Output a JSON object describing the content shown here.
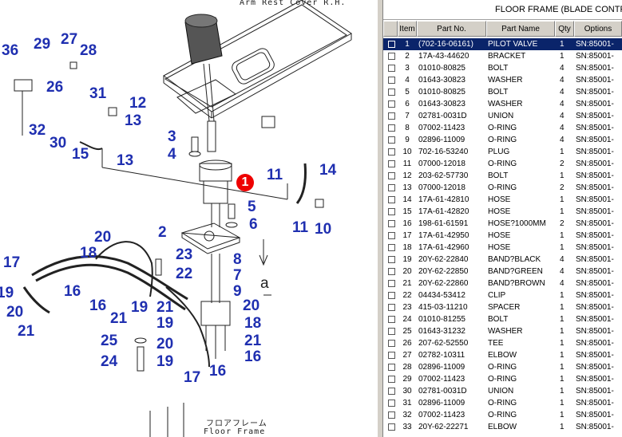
{
  "diagram": {
    "top_text": "Arm Rest Cover R.H.",
    "floor_label_jp": "フロアフレーム",
    "floor_label_en": "Floor Frame",
    "callouts": [
      {
        "id": "1",
        "label": "1",
        "selected": true
      },
      {
        "id": "36a",
        "label": "36"
      },
      {
        "id": "29",
        "label": "29"
      },
      {
        "id": "27",
        "label": "27"
      },
      {
        "id": "28",
        "label": "28"
      },
      {
        "id": "26",
        "label": "26"
      },
      {
        "id": "31",
        "label": "31"
      },
      {
        "id": "12",
        "label": "12"
      },
      {
        "id": "13a",
        "label": "13"
      },
      {
        "id": "32",
        "label": "32"
      },
      {
        "id": "30",
        "label": "30"
      },
      {
        "id": "15",
        "label": "15"
      },
      {
        "id": "13b",
        "label": "13"
      },
      {
        "id": "3",
        "label": "3"
      },
      {
        "id": "4",
        "label": "4"
      },
      {
        "id": "11a",
        "label": "11"
      },
      {
        "id": "14",
        "label": "14"
      },
      {
        "id": "5",
        "label": "5"
      },
      {
        "id": "6",
        "label": "6"
      },
      {
        "id": "11b",
        "label": "11"
      },
      {
        "id": "10",
        "label": "10"
      },
      {
        "id": "2",
        "label": "2"
      },
      {
        "id": "20a",
        "label": "20"
      },
      {
        "id": "18a",
        "label": "18"
      },
      {
        "id": "8",
        "label": "8"
      },
      {
        "id": "23",
        "label": "23"
      },
      {
        "id": "17a",
        "label": "17"
      },
      {
        "id": "22",
        "label": "22"
      },
      {
        "id": "7",
        "label": "7"
      },
      {
        "id": "9",
        "label": "9"
      },
      {
        "id": "19a",
        "label": "19"
      },
      {
        "id": "16a",
        "label": "16"
      },
      {
        "id": "16b",
        "label": "16"
      },
      {
        "id": "19b",
        "label": "19"
      },
      {
        "id": "21a",
        "label": "21"
      },
      {
        "id": "20b",
        "label": "20"
      },
      {
        "id": "21b",
        "label": "21"
      },
      {
        "id": "21c",
        "label": "21"
      },
      {
        "id": "19c",
        "label": "19"
      },
      {
        "id": "20c",
        "label": "20"
      },
      {
        "id": "18b",
        "label": "18"
      },
      {
        "id": "21d",
        "label": "21"
      },
      {
        "id": "25",
        "label": "25"
      },
      {
        "id": "20d",
        "label": "20"
      },
      {
        "id": "16c",
        "label": "16"
      },
      {
        "id": "24",
        "label": "24"
      },
      {
        "id": "19d",
        "label": "19"
      },
      {
        "id": "17b",
        "label": "17"
      },
      {
        "id": "16d",
        "label": "16"
      },
      {
        "id": "a",
        "label": "a"
      }
    ]
  },
  "panel": {
    "title": "FLOOR FRAME (BLADE CONTROL",
    "columns": [
      "Item",
      "Part No.",
      "Part Name",
      "Qty",
      "Options"
    ],
    "rows": [
      {
        "item": "1",
        "part": "(702-16-06161)",
        "name": "PILOT VALVE",
        "qty": "1",
        "opt": "SN:85001-",
        "selected": true
      },
      {
        "item": "2",
        "part": "17A-43-44620",
        "name": "BRACKET",
        "qty": "1",
        "opt": "SN:85001-"
      },
      {
        "item": "3",
        "part": "01010-80825",
        "name": "BOLT",
        "qty": "4",
        "opt": "SN:85001-"
      },
      {
        "item": "4",
        "part": "01643-30823",
        "name": "WASHER",
        "qty": "4",
        "opt": "SN:85001-"
      },
      {
        "item": "5",
        "part": "01010-80825",
        "name": "BOLT",
        "qty": "4",
        "opt": "SN:85001-"
      },
      {
        "item": "6",
        "part": "01643-30823",
        "name": "WASHER",
        "qty": "4",
        "opt": "SN:85001-"
      },
      {
        "item": "7",
        "part": "02781-0031D",
        "name": "UNION",
        "qty": "4",
        "opt": "SN:85001-"
      },
      {
        "item": "8",
        "part": "07002-11423",
        "name": "O-RING",
        "qty": "4",
        "opt": "SN:85001-"
      },
      {
        "item": "9",
        "part": "02896-11009",
        "name": "O-RING",
        "qty": "4",
        "opt": "SN:85001-"
      },
      {
        "item": "10",
        "part": "702-16-53240",
        "name": "PLUG",
        "qty": "1",
        "opt": "SN:85001-"
      },
      {
        "item": "11",
        "part": "07000-12018",
        "name": "O-RING",
        "qty": "2",
        "opt": "SN:85001-"
      },
      {
        "item": "12",
        "part": "203-62-57730",
        "name": "BOLT",
        "qty": "1",
        "opt": "SN:85001-"
      },
      {
        "item": "13",
        "part": "07000-12018",
        "name": "O-RING",
        "qty": "2",
        "opt": "SN:85001-"
      },
      {
        "item": "14",
        "part": "17A-61-42810",
        "name": "HOSE",
        "qty": "1",
        "opt": "SN:85001-"
      },
      {
        "item": "15",
        "part": "17A-61-42820",
        "name": "HOSE",
        "qty": "1",
        "opt": "SN:85001-"
      },
      {
        "item": "16",
        "part": "198-61-61591",
        "name": "HOSE?1000MM",
        "qty": "2",
        "opt": "SN:85001-"
      },
      {
        "item": "17",
        "part": "17A-61-42950",
        "name": "HOSE",
        "qty": "1",
        "opt": "SN:85001-"
      },
      {
        "item": "18",
        "part": "17A-61-42960",
        "name": "HOSE",
        "qty": "1",
        "opt": "SN:85001-"
      },
      {
        "item": "19",
        "part": "20Y-62-22840",
        "name": "BAND?BLACK",
        "qty": "4",
        "opt": "SN:85001-"
      },
      {
        "item": "20",
        "part": "20Y-62-22850",
        "name": "BAND?GREEN",
        "qty": "4",
        "opt": "SN:85001-"
      },
      {
        "item": "21",
        "part": "20Y-62-22860",
        "name": "BAND?BROWN",
        "qty": "4",
        "opt": "SN:85001-"
      },
      {
        "item": "22",
        "part": "04434-53412",
        "name": "CLIP",
        "qty": "1",
        "opt": "SN:85001-"
      },
      {
        "item": "23",
        "part": "415-03-11210",
        "name": "SPACER",
        "qty": "1",
        "opt": "SN:85001-"
      },
      {
        "item": "24",
        "part": "01010-81255",
        "name": "BOLT",
        "qty": "1",
        "opt": "SN:85001-"
      },
      {
        "item": "25",
        "part": "01643-31232",
        "name": "WASHER",
        "qty": "1",
        "opt": "SN:85001-"
      },
      {
        "item": "26",
        "part": "207-62-52550",
        "name": "TEE",
        "qty": "1",
        "opt": "SN:85001-"
      },
      {
        "item": "27",
        "part": "02782-10311",
        "name": "ELBOW",
        "qty": "1",
        "opt": "SN:85001-"
      },
      {
        "item": "28",
        "part": "02896-11009",
        "name": "O-RING",
        "qty": "1",
        "opt": "SN:85001-"
      },
      {
        "item": "29",
        "part": "07002-11423",
        "name": "O-RING",
        "qty": "1",
        "opt": "SN:85001-"
      },
      {
        "item": "30",
        "part": "02781-0031D",
        "name": "UNION",
        "qty": "1",
        "opt": "SN:85001-"
      },
      {
        "item": "31",
        "part": "02896-11009",
        "name": "O-RING",
        "qty": "1",
        "opt": "SN:85001-"
      },
      {
        "item": "32",
        "part": "07002-11423",
        "name": "O-RING",
        "qty": "1",
        "opt": "SN:85001-"
      },
      {
        "item": "33",
        "part": "20Y-62-22271",
        "name": "ELBOW",
        "qty": "1",
        "opt": "SN:85001-"
      }
    ]
  },
  "colors": {
    "callout": "#1f2fb0",
    "selection": "#0a246a",
    "highlight": "#e00000"
  }
}
